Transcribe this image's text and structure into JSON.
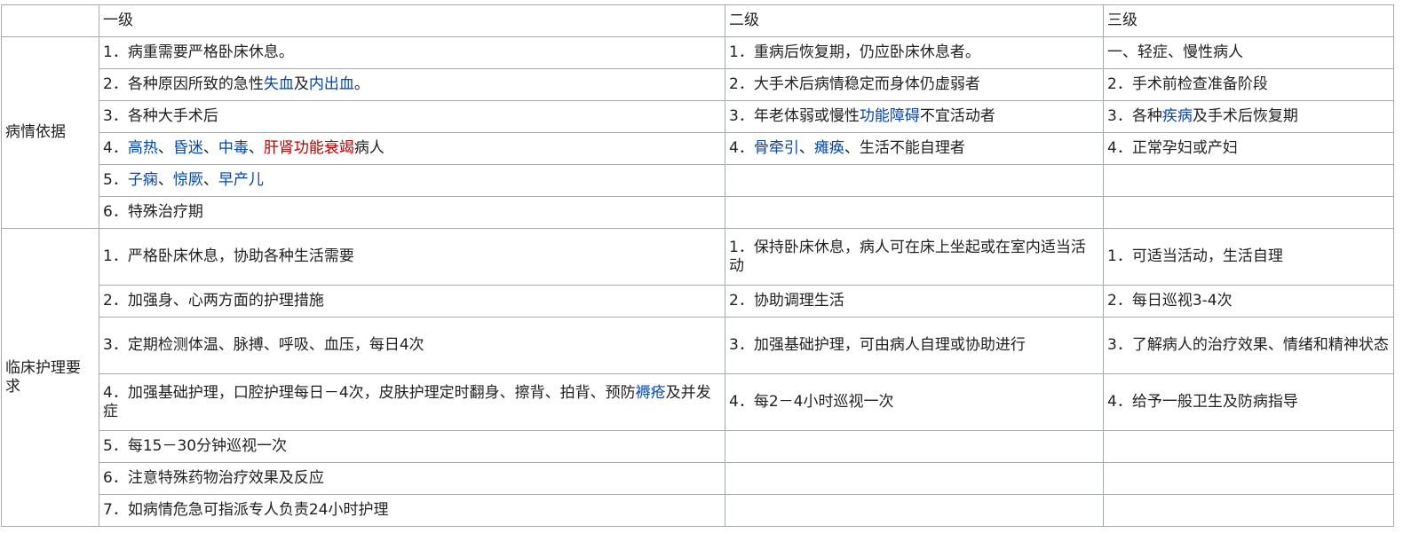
{
  "headers": {
    "corner": "",
    "level1": "一级",
    "level2": "二级",
    "level3": "三级"
  },
  "sections": {
    "basis": {
      "label": "病情依据",
      "rows": [
        {
          "l1": [
            {
              "t": "1．病重需要严格卧床休息。"
            }
          ],
          "l2": [
            {
              "t": "1．重病后恢复期，仍应卧床休息者。"
            }
          ],
          "l3": [
            {
              "t": "一、轻症、慢性病人"
            }
          ]
        },
        {
          "l1": [
            {
              "t": "2．各种原因所致的急性"
            },
            {
              "t": "失血",
              "link": true
            },
            {
              "t": "及"
            },
            {
              "t": "内出血",
              "link": true
            },
            {
              "t": "。"
            }
          ],
          "l2": [
            {
              "t": "2．大手术后病情稳定而身体仍虚弱者"
            }
          ],
          "l3": [
            {
              "t": "2．手术前检查准备阶段"
            }
          ]
        },
        {
          "l1": [
            {
              "t": "3．各种大手术后"
            }
          ],
          "l2": [
            {
              "t": "3．年老体弱或慢性"
            },
            {
              "t": "功能障碍",
              "link": true
            },
            {
              "t": "不宜活动者"
            }
          ],
          "l3": [
            {
              "t": "3．各种"
            },
            {
              "t": "疾病",
              "link": true
            },
            {
              "t": "及手术后恢复期"
            }
          ]
        },
        {
          "l1": [
            {
              "t": "4．"
            },
            {
              "t": "高热",
              "link": true
            },
            {
              "t": "、"
            },
            {
              "t": "昏迷",
              "link": true
            },
            {
              "t": "、"
            },
            {
              "t": "中毒",
              "link": true
            },
            {
              "t": "、"
            },
            {
              "t": "肝肾功能衰竭",
              "link": true,
              "new": true
            },
            {
              "t": "病人"
            }
          ],
          "l2": [
            {
              "t": "4．"
            },
            {
              "t": "骨牵引",
              "link": true
            },
            {
              "t": "、"
            },
            {
              "t": "瘫痪",
              "link": true
            },
            {
              "t": "、生活不能自理者"
            }
          ],
          "l3": [
            {
              "t": "4．正常孕妇或产妇"
            }
          ]
        },
        {
          "l1": [
            {
              "t": "5．"
            },
            {
              "t": "子痫",
              "link": true
            },
            {
              "t": "、"
            },
            {
              "t": "惊厥",
              "link": true
            },
            {
              "t": "、"
            },
            {
              "t": "早产儿",
              "link": true
            }
          ],
          "l2": [],
          "l3": []
        },
        {
          "l1": [
            {
              "t": "6．特殊治疗期"
            }
          ],
          "l2": [],
          "l3": []
        }
      ]
    },
    "care": {
      "label": "临床护理要求",
      "rows": [
        {
          "l1": [
            {
              "t": "1．严格卧床休息，协助各种生活需要"
            }
          ],
          "l2": [
            {
              "t": "1．保持卧床休息，病人可在床上坐起或在室内适当活动"
            }
          ],
          "l3": [
            {
              "t": "1．可适当活动，生活自理"
            }
          ]
        },
        {
          "l1": [
            {
              "t": "2．加强身、心两方面的护理措施"
            }
          ],
          "l2": [
            {
              "t": "2．协助调理生活"
            }
          ],
          "l3": [
            {
              "t": "2．每日巡视3-4次"
            }
          ]
        },
        {
          "l1": [
            {
              "t": "3．定期检测体温、脉搏、呼吸、血压，每日4次"
            }
          ],
          "l2": [
            {
              "t": "3．加强基础护理，可由病人自理或协助进行"
            }
          ],
          "l3": [
            {
              "t": "3．了解病人的治疗效果、情绪和精神状态"
            }
          ]
        },
        {
          "l1": [
            {
              "t": "4．加强基础护理，口腔护理每日－4次，皮肤护理定时翻身、擦背、拍背、预防"
            },
            {
              "t": "褥疮",
              "link": true
            },
            {
              "t": "及并发症"
            }
          ],
          "l2": [
            {
              "t": "4．每2－4小时巡视一次"
            }
          ],
          "l3": [
            {
              "t": "4．给予一般卫生及防病指导"
            }
          ]
        },
        {
          "l1": [
            {
              "t": "5．每15－30分钟巡视一次"
            }
          ],
          "l2": [],
          "l3": []
        },
        {
          "l1": [
            {
              "t": "6．注意特殊药物治疗效果及反应"
            }
          ],
          "l2": [],
          "l3": []
        },
        {
          "l1": [
            {
              "t": "7．如病情危急可指派专人负责24小时护理"
            }
          ],
          "l2": [],
          "l3": []
        }
      ]
    }
  }
}
